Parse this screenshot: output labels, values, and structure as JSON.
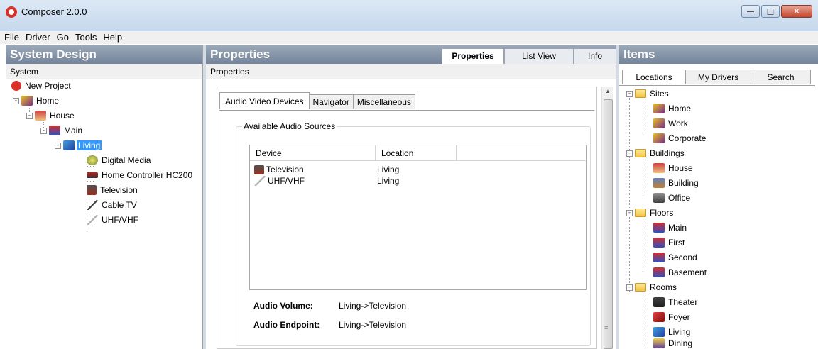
{
  "window": {
    "title": "Composer 2.0.0"
  },
  "menu": [
    "File",
    "Driver",
    "Go",
    "Tools",
    "Help"
  ],
  "system_design": {
    "header": "System Design",
    "subheader": "System",
    "tree": [
      {
        "label": "New Project"
      },
      {
        "label": "Home"
      },
      {
        "label": "House"
      },
      {
        "label": "Main"
      },
      {
        "label": "Living",
        "selected": true
      },
      {
        "label": "Digital Media"
      },
      {
        "label": "Home Controller HC200"
      },
      {
        "label": "Television"
      },
      {
        "label": "Cable TV"
      },
      {
        "label": "UHF/VHF"
      }
    ]
  },
  "properties": {
    "header": "Properties",
    "subheader": "Properties",
    "top_tabs": [
      "Properties",
      "List View",
      "Info"
    ],
    "inner_tabs": [
      "Audio Video Devices",
      "Navigator",
      "Miscellaneous"
    ],
    "group_title": "Available Audio Sources",
    "columns": [
      "Device",
      "Location"
    ],
    "rows": [
      {
        "device": "Television",
        "location": "Living"
      },
      {
        "device": "UHF/VHF",
        "location": "Living"
      }
    ],
    "audio_volume_label": "Audio Volume:",
    "audio_volume_value": "Living->Television",
    "audio_endpoint_label": "Audio Endpoint:",
    "audio_endpoint_value": "Living->Television"
  },
  "items": {
    "header": "Items",
    "tabs": [
      "Locations",
      "My Drivers",
      "Search"
    ],
    "tree": {
      "sites": {
        "label": "Sites",
        "children": [
          "Home",
          "Work",
          "Corporate"
        ]
      },
      "buildings": {
        "label": "Buildings",
        "children": [
          "House",
          "Building",
          "Office"
        ]
      },
      "floors": {
        "label": "Floors",
        "children": [
          "Main",
          "First",
          "Second",
          "Basement"
        ]
      },
      "rooms": {
        "label": "Rooms",
        "children": [
          "Theater",
          "Foyer",
          "Living",
          "Dining"
        ]
      }
    }
  },
  "colors": {
    "selection": "#3399ff",
    "panel_header": "#74849a",
    "logo": "#d9302a"
  }
}
